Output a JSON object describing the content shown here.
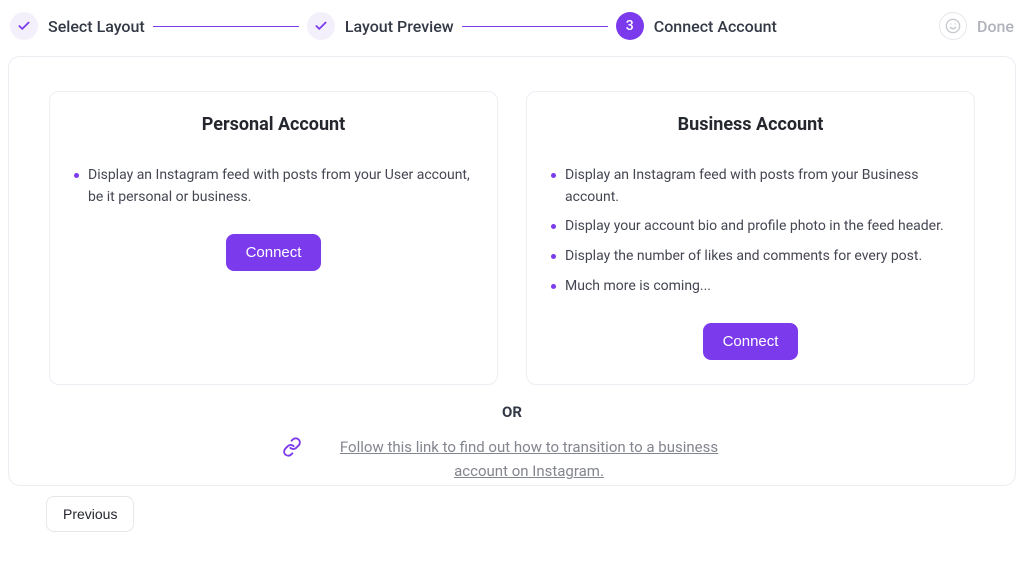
{
  "stepper": {
    "steps": [
      {
        "label": "Select Layout"
      },
      {
        "label": "Layout Preview"
      },
      {
        "label": "Connect Account",
        "number": "3"
      },
      {
        "label": "Done"
      }
    ]
  },
  "cards": {
    "personal": {
      "title": "Personal Account",
      "bullets": [
        "Display an Instagram feed with posts from your User account, be it personal or business."
      ],
      "connect_label": "Connect"
    },
    "business": {
      "title": "Business Account",
      "bullets": [
        "Display an Instagram feed with posts from your Business account.",
        "Display your account bio and profile photo in the feed header.",
        "Display the number of likes and comments for every post.",
        "Much more is coming..."
      ],
      "connect_label": "Connect"
    }
  },
  "or_label": "OR",
  "help_link": "Follow this link to find out how to transition to a business account on Instagram.",
  "footer": {
    "previous_label": "Previous"
  }
}
